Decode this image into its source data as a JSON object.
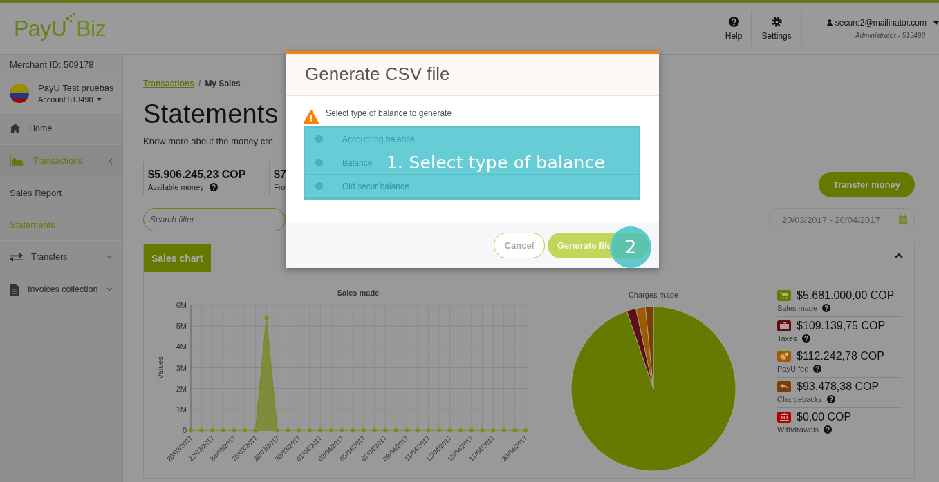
{
  "header": {
    "logo": {
      "brand": "PayU",
      "product": "Biz"
    },
    "help": "Help",
    "settings": "Settings",
    "user": {
      "email": "secure2@mailinator.com",
      "role": "Administrator - 513498"
    }
  },
  "sidebar": {
    "merchant_id": "Merchant ID: 509178",
    "account": {
      "name": "PayU Test pruebas",
      "number": "Account 513498"
    },
    "items": [
      {
        "label": "Home",
        "kind": "home",
        "selected": false
      },
      {
        "label": "Transactions",
        "kind": "chart",
        "selected": true,
        "expanded": true,
        "children": [
          {
            "label": "Sales Report",
            "selected": false
          },
          {
            "label": "Statements",
            "selected": true
          }
        ]
      },
      {
        "label": "Transfers",
        "kind": "transfer",
        "selected": false,
        "expanded": false
      },
      {
        "label": "Invoices collection",
        "kind": "document",
        "selected": false,
        "expanded": false
      }
    ]
  },
  "main": {
    "breadcrumb": {
      "items": [
        "Transactions",
        "My Sales"
      ],
      "separator": "/"
    },
    "title": "Statements",
    "subtitle": "Know more about the money cre",
    "balances": [
      {
        "amount": "$5.906.245,23 COP",
        "label": "Available money",
        "help": true
      },
      {
        "amount": "$7",
        "label": "Fro"
      }
    ],
    "transfer_button": "Transfer money",
    "search": {
      "placeholder": "Search filter"
    },
    "date_range": "20/03/2017 - 20/04/2017",
    "panel": {
      "tab": "Sales chart",
      "expanded": true,
      "line_chart": {
        "chart_data": {
          "type": "area",
          "title": "Sales made",
          "ylabel": "Values",
          "categories": [
            "20/03/2017",
            null,
            "22/03/2017",
            null,
            "24/03/2017",
            null,
            "26/03/2017",
            null,
            "28/03/2017",
            null,
            "30/03/2017",
            null,
            "01/04/2017",
            null,
            "03/04/2017",
            null,
            "05/04/2017",
            null,
            "07/04/2017",
            null,
            "09/04/2017",
            null,
            "11/04/2017",
            null,
            "13/04/2017",
            null,
            "15/04/2017",
            null,
            "17/04/2017",
            null,
            null,
            "20/04/2017"
          ],
          "grid": true,
          "series": [
            {
              "color": "#7a8a2a",
              "values": [
                0,
                0,
                0,
                0,
                0,
                0,
                0,
                5370000,
                0,
                0,
                0,
                0,
                0,
                0,
                0,
                0,
                0,
                0,
                0,
                0,
                0,
                0,
                0,
                0,
                0,
                0,
                0,
                0,
                0,
                0,
                0,
                0
              ]
            }
          ],
          "ylim": [
            0,
            6000000
          ],
          "yticks": [
            {
              "value": 0,
              "label": "0"
            },
            {
              "value": 1000000,
              "label": "1M"
            },
            {
              "value": 2000000,
              "label": "2M"
            },
            {
              "value": 3000000,
              "label": "3M"
            },
            {
              "value": 4000000,
              "label": "4M"
            },
            {
              "value": 5000000,
              "label": "5M"
            },
            {
              "value": 6000000,
              "label": "6M"
            }
          ]
        }
      },
      "pie_chart": {
        "chart_data": {
          "type": "pie",
          "title": "Charges made",
          "values": [
            94.75,
            1.82,
            1.87,
            1.56,
            0
          ]
        }
      },
      "summary": [
        {
          "amount": "$5.681.000,00 COP",
          "label": "Sales made",
          "kind": "cart",
          "color": "#657a00"
        },
        {
          "amount": "$109.139,75 COP",
          "label": "Taxes",
          "kind": "briefcase",
          "color": "#5e1016"
        },
        {
          "amount": "$112.242,78 COP",
          "label": "PayU fee",
          "kind": "gears",
          "color": "#9e5a00"
        },
        {
          "amount": "$93.478,38 COP",
          "label": "Chargebacks",
          "kind": "reply",
          "color": "#7a3e00"
        },
        {
          "amount": "$0,00 COP",
          "label": "Withdrawals",
          "kind": "bank",
          "color": "#b00000"
        }
      ]
    }
  },
  "modal": {
    "title": "Generate CSV file",
    "message": "Select type of balance to generate",
    "options": [
      {
        "label": "Accounting balance",
        "selected": false
      },
      {
        "label": "Balance",
        "selected": false
      },
      {
        "label": "Old secur balance",
        "selected": false
      }
    ],
    "buttons": {
      "cancel": "Cancel",
      "generate": "Generate file"
    },
    "tutorial": {
      "step_1": "1. Select type of balance",
      "step_2": "2"
    }
  }
}
